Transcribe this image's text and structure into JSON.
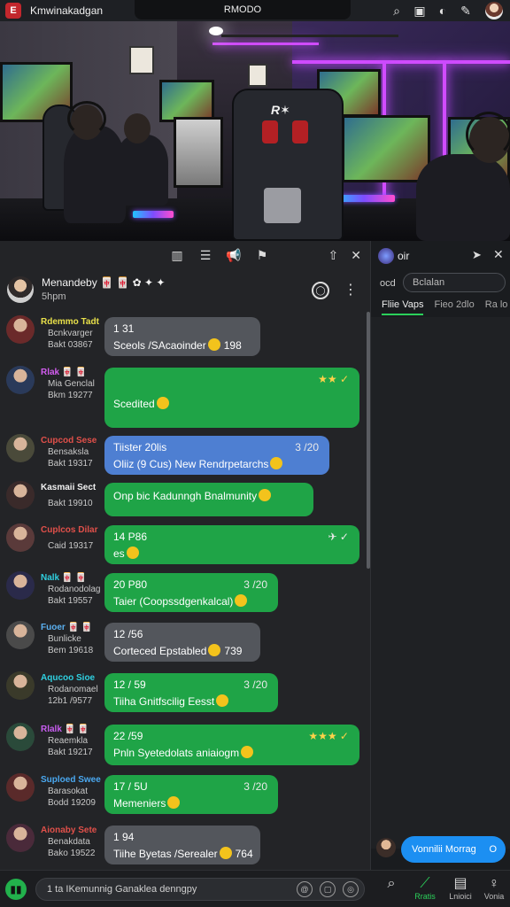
{
  "topbar": {
    "app_badge": "E",
    "app_title": "Kmwinakadgan",
    "stream_title": "RMODO"
  },
  "chat": {
    "pinned": {
      "name": "Menandeby 🀄 🀄 ✿ ✦ ✦",
      "sub": "5hpm"
    },
    "messages": [
      {
        "user": "Rdemmo Tadt",
        "user_color": "#e8e04a",
        "role": "Bcnkvarger",
        "meta": "Bakt 03867",
        "bubble_color": "gray",
        "l1": "1 31",
        "l2": "Sceols /SAcaoinder",
        "right": "",
        "tail": "198"
      },
      {
        "user": "Rlak 🀄 🀄",
        "user_color": "#d35df0",
        "role": "Mia Genclal",
        "meta": "Bkm 19277",
        "bubble_color": "green",
        "l1": "",
        "l2": "Scedited",
        "right": "★★ ✓",
        "tail": ""
      },
      {
        "user": "Cupcod Sese",
        "user_color": "#e0504a",
        "role": "Bensaksla",
        "meta": "Bakt 19317",
        "bubble_color": "blue",
        "l1": "Tiister 20lis",
        "l2": "Oliiz (9 Cus) New Rendrpetarchs",
        "right": "3 /20",
        "tail": ""
      },
      {
        "user": "Kasmaii Sect",
        "user_color": "#f0f0f0",
        "role": "",
        "meta": "Bakt 19910",
        "bubble_color": "green",
        "l1": "",
        "l2": "Onp bic Kadunngh Bnalmunity",
        "right": "",
        "tail": ""
      },
      {
        "user": "Cuplcos Dilar",
        "user_color": "#e0504a",
        "role": "",
        "meta": "Caid 19317",
        "bubble_color": "green",
        "l1": "14 P86",
        "l2": "es",
        "right": "✈ ✓",
        "tail": ""
      },
      {
        "user": "Nalk 🀄 🀄",
        "user_color": "#2fd0e0",
        "role": "Rodanodolag",
        "meta": "Bakt 19557",
        "bubble_color": "green",
        "l1": "20 P80",
        "l2": "Taier (Coopssdgenkalcal)",
        "right": "3 /20",
        "tail": ""
      },
      {
        "user": "Fuoer 🀄 🀄",
        "user_color": "#5bb0f0",
        "role": "Bunlicke",
        "meta": "Bem 19618",
        "bubble_color": "gray",
        "l1": "12 /56",
        "l2": "Corteced Epstabled",
        "right": "",
        "tail": "739"
      },
      {
        "user": "Aqucoo Sioe",
        "user_color": "#2fd0e0",
        "role": "Rodanomael",
        "meta": "12b1 /9577",
        "bubble_color": "green",
        "l1": "12 / 59",
        "l2": "Tiiha Gnitfscilig Eesst",
        "right": "3 /20",
        "tail": ""
      },
      {
        "user": "Rlalk 🀄 🀄",
        "user_color": "#c85df0",
        "role": "Reaemkla",
        "meta": "Bakt 19217",
        "bubble_color": "green",
        "l1": "22 /59",
        "l2": "Pnln Syetedolats aniaiogm",
        "right": "★★★ ✓",
        "tail": ""
      },
      {
        "user": "Suploed Swee",
        "user_color": "#4aa8f0",
        "role": "Barasokat",
        "meta": "Bodd 19209",
        "bubble_color": "green",
        "l1": "17 / 5U",
        "l2": "Memeniers",
        "right": "3 /20",
        "tail": ""
      },
      {
        "user": "Aionaby Sete",
        "user_color": "#e0504a",
        "role": "Benakdata",
        "meta": "Bako 19522",
        "bubble_color": "gray",
        "l1": "1 94",
        "l2": "Tiihe Byetas /Serealer",
        "right": "",
        "tail": "764"
      }
    ]
  },
  "side_panel": {
    "title": "oir",
    "search_label": "ocd",
    "search_placeholder": "Bclalan",
    "tabs": [
      "Fliie Vaps",
      "Fieo 2dlo",
      "Ra lo"
    ],
    "composer_message": "Vonnilii Morrag",
    "composer_dot": "O"
  },
  "bottombar": {
    "compose_placeholder": "1  ta IKemunnig Ganaklea denngpy",
    "nav": [
      {
        "icon": "search-icon",
        "label": ""
      },
      {
        "icon": "stats-icon",
        "label": "Rratis"
      },
      {
        "icon": "box-icon",
        "label": "Lnioici"
      },
      {
        "icon": "user-icon",
        "label": "Vonia"
      }
    ]
  }
}
